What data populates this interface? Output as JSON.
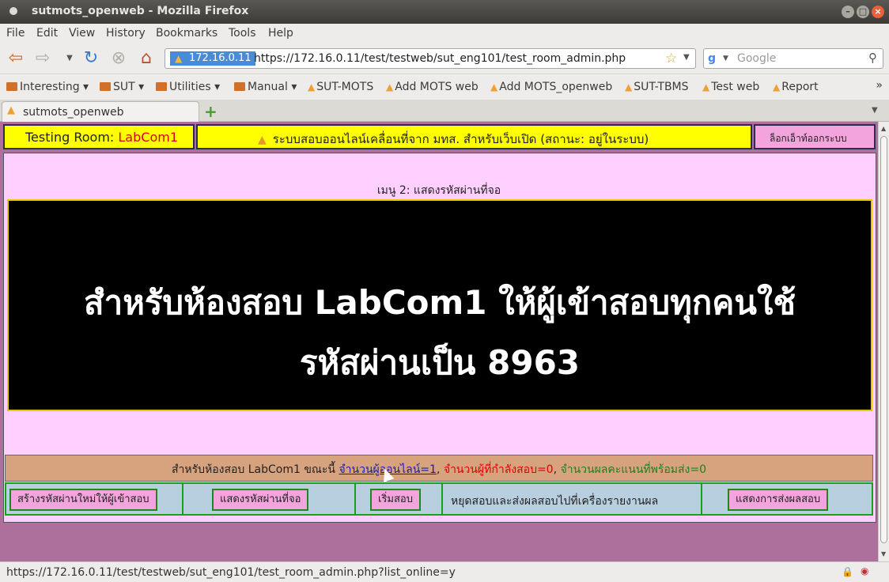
{
  "window": {
    "title": "sutmots_openweb - Mozilla Firefox"
  },
  "menubar": {
    "items": [
      "File",
      "Edit",
      "View",
      "History",
      "Bookmarks",
      "Tools",
      "Help"
    ]
  },
  "nav": {
    "site_badge": "172.16.0.11",
    "url": "https://172.16.0.11/test/testweb/sut_eng101/test_room_admin.php",
    "search_placeholder": "Google"
  },
  "bookmarks": {
    "items": [
      {
        "label": "Interesting",
        "type": "folder"
      },
      {
        "label": "SUT",
        "type": "folder"
      },
      {
        "label": "Utilities",
        "type": "folder"
      },
      {
        "label": "Manual",
        "type": "folder"
      },
      {
        "label": "SUT-MOTS",
        "type": "link"
      },
      {
        "label": "Add MOTS web",
        "type": "link"
      },
      {
        "label": "Add MOTS_openweb",
        "type": "link"
      },
      {
        "label": "SUT-TBMS",
        "type": "link"
      },
      {
        "label": "Test web",
        "type": "link"
      },
      {
        "label": "Report",
        "type": "link"
      }
    ]
  },
  "tab": {
    "label": "sutmots_openweb"
  },
  "header": {
    "room_label": "Testing  Room:",
    "room_name": "LabCom1",
    "system_text": "ระบบสอบออนไลน์เคลื่อนที่จาก มทส. สำหรับเว็บเปิด (สถานะ: อยู่ในระบบ)",
    "logout": "ล็อกเอ็าท์ออกระบบ"
  },
  "main": {
    "menu_title": "เมนู 2: แสดงรหัสผ่านที่จอ",
    "big_line1": "สำหรับห้องสอบ LabCom1 ให้ผู้เข้าสอบทุกคนใช้",
    "big_line2": "รหัสผ่านเป็น 8963"
  },
  "status": {
    "prefix": "สำหรับห้องสอบ  LabCom1  ขณะนี้ ",
    "online_link": "จำนวนผู้ออนไลน์=1",
    "sep1": ", ",
    "testing": "จำนวนผู้ที่กำลังสอบ=0",
    "sep2": ", ",
    "ready": "จำนวนผลคะแนนที่พร้อมส่ง=0"
  },
  "actions": {
    "create_password": "สร้างรหัสผ่านใหม่ให้ผู้เข้าสอบ",
    "show_password": "แสดงรหัสผ่านที่จอ",
    "start_test": "เริ่มสอบ",
    "stop_label": "หยุดสอบและส่งผลสอบไปที่เครื่องรายงานผล",
    "show_results": "แสดงการส่งผลสอบ"
  },
  "statusbar": {
    "url": "https://172.16.0.11/test/testweb/sut_eng101/test_room_admin.php?list_online=y"
  }
}
